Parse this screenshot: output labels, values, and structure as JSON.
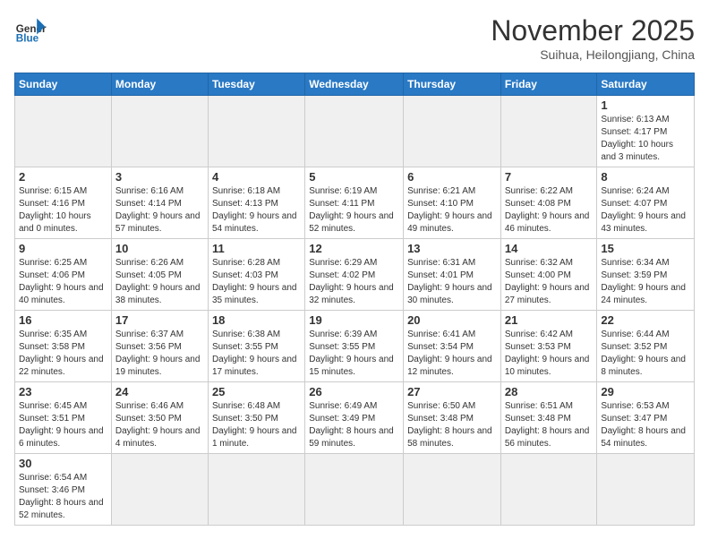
{
  "header": {
    "logo_general": "General",
    "logo_blue": "Blue",
    "month_title": "November 2025",
    "subtitle": "Suihua, Heilongjiang, China"
  },
  "weekdays": [
    "Sunday",
    "Monday",
    "Tuesday",
    "Wednesday",
    "Thursday",
    "Friday",
    "Saturday"
  ],
  "days": {
    "1": {
      "sunrise": "6:13 AM",
      "sunset": "4:17 PM",
      "daylight": "10 hours and 3 minutes."
    },
    "2": {
      "sunrise": "6:15 AM",
      "sunset": "4:16 PM",
      "daylight": "10 hours and 0 minutes."
    },
    "3": {
      "sunrise": "6:16 AM",
      "sunset": "4:14 PM",
      "daylight": "9 hours and 57 minutes."
    },
    "4": {
      "sunrise": "6:18 AM",
      "sunset": "4:13 PM",
      "daylight": "9 hours and 54 minutes."
    },
    "5": {
      "sunrise": "6:19 AM",
      "sunset": "4:11 PM",
      "daylight": "9 hours and 52 minutes."
    },
    "6": {
      "sunrise": "6:21 AM",
      "sunset": "4:10 PM",
      "daylight": "9 hours and 49 minutes."
    },
    "7": {
      "sunrise": "6:22 AM",
      "sunset": "4:08 PM",
      "daylight": "9 hours and 46 minutes."
    },
    "8": {
      "sunrise": "6:24 AM",
      "sunset": "4:07 PM",
      "daylight": "9 hours and 43 minutes."
    },
    "9": {
      "sunrise": "6:25 AM",
      "sunset": "4:06 PM",
      "daylight": "9 hours and 40 minutes."
    },
    "10": {
      "sunrise": "6:26 AM",
      "sunset": "4:05 PM",
      "daylight": "9 hours and 38 minutes."
    },
    "11": {
      "sunrise": "6:28 AM",
      "sunset": "4:03 PM",
      "daylight": "9 hours and 35 minutes."
    },
    "12": {
      "sunrise": "6:29 AM",
      "sunset": "4:02 PM",
      "daylight": "9 hours and 32 minutes."
    },
    "13": {
      "sunrise": "6:31 AM",
      "sunset": "4:01 PM",
      "daylight": "9 hours and 30 minutes."
    },
    "14": {
      "sunrise": "6:32 AM",
      "sunset": "4:00 PM",
      "daylight": "9 hours and 27 minutes."
    },
    "15": {
      "sunrise": "6:34 AM",
      "sunset": "3:59 PM",
      "daylight": "9 hours and 24 minutes."
    },
    "16": {
      "sunrise": "6:35 AM",
      "sunset": "3:58 PM",
      "daylight": "9 hours and 22 minutes."
    },
    "17": {
      "sunrise": "6:37 AM",
      "sunset": "3:56 PM",
      "daylight": "9 hours and 19 minutes."
    },
    "18": {
      "sunrise": "6:38 AM",
      "sunset": "3:55 PM",
      "daylight": "9 hours and 17 minutes."
    },
    "19": {
      "sunrise": "6:39 AM",
      "sunset": "3:55 PM",
      "daylight": "9 hours and 15 minutes."
    },
    "20": {
      "sunrise": "6:41 AM",
      "sunset": "3:54 PM",
      "daylight": "9 hours and 12 minutes."
    },
    "21": {
      "sunrise": "6:42 AM",
      "sunset": "3:53 PM",
      "daylight": "9 hours and 10 minutes."
    },
    "22": {
      "sunrise": "6:44 AM",
      "sunset": "3:52 PM",
      "daylight": "9 hours and 8 minutes."
    },
    "23": {
      "sunrise": "6:45 AM",
      "sunset": "3:51 PM",
      "daylight": "9 hours and 6 minutes."
    },
    "24": {
      "sunrise": "6:46 AM",
      "sunset": "3:50 PM",
      "daylight": "9 hours and 4 minutes."
    },
    "25": {
      "sunrise": "6:48 AM",
      "sunset": "3:50 PM",
      "daylight": "9 hours and 1 minute."
    },
    "26": {
      "sunrise": "6:49 AM",
      "sunset": "3:49 PM",
      "daylight": "8 hours and 59 minutes."
    },
    "27": {
      "sunrise": "6:50 AM",
      "sunset": "3:48 PM",
      "daylight": "8 hours and 58 minutes."
    },
    "28": {
      "sunrise": "6:51 AM",
      "sunset": "3:48 PM",
      "daylight": "8 hours and 56 minutes."
    },
    "29": {
      "sunrise": "6:53 AM",
      "sunset": "3:47 PM",
      "daylight": "8 hours and 54 minutes."
    },
    "30": {
      "sunrise": "6:54 AM",
      "sunset": "3:46 PM",
      "daylight": "8 hours and 52 minutes."
    }
  }
}
